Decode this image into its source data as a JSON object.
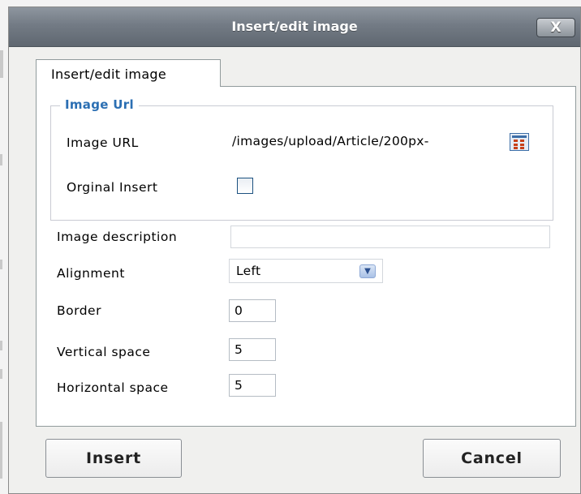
{
  "dialog": {
    "title": "Insert/edit image",
    "close_label": "X"
  },
  "tab": {
    "label": "Insert/edit image"
  },
  "image_url_group": {
    "legend": "Image Url",
    "image_url_label": "Image URL",
    "image_url_value": "/images/upload/Article/200px-",
    "original_insert_label": "Orginal Insert",
    "original_insert_checked": false
  },
  "fields": {
    "image_description_label": "Image description",
    "image_description_value": "",
    "alignment_label": "Alignment",
    "alignment_value": "Left",
    "border_label": "Border",
    "border_value": "0",
    "vertical_space_label": "Vertical space",
    "vertical_space_value": "5",
    "horizontal_space_label": "Horizontal space",
    "horizontal_space_value": "5"
  },
  "buttons": {
    "insert_label": "Insert",
    "cancel_label": "Cancel"
  },
  "colors": {
    "titlebar": "#737b85",
    "legend": "#2b6fb3",
    "dialog_bg": "#f0f0ee"
  }
}
